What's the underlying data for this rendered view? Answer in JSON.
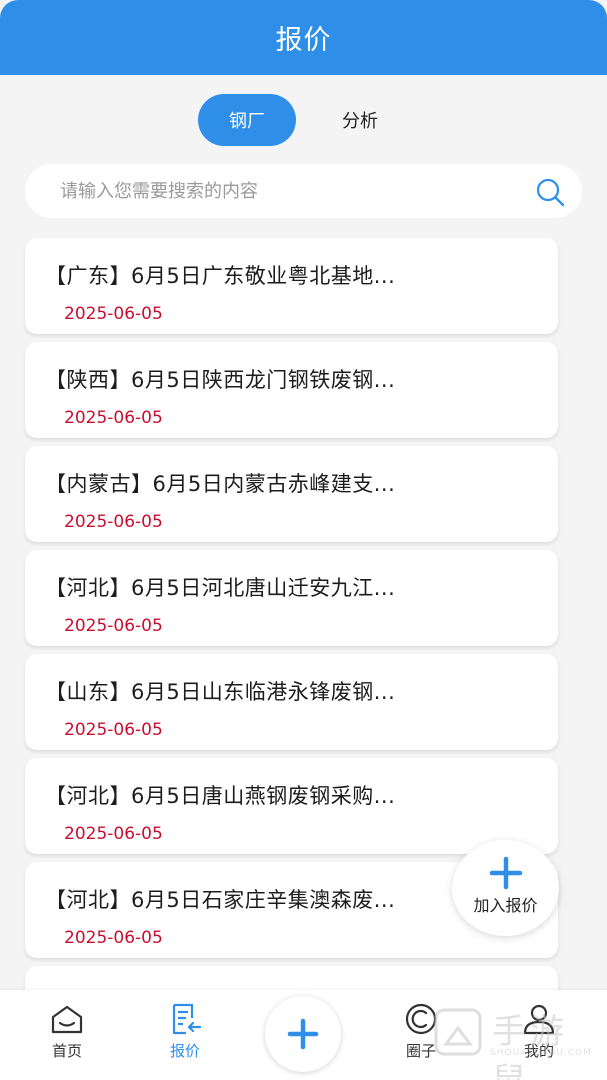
{
  "header": {
    "title": "报价"
  },
  "tabs": [
    {
      "label": "钢厂",
      "active": true
    },
    {
      "label": "分析",
      "active": false
    }
  ],
  "search": {
    "placeholder": "请输入您需要搜索的内容",
    "value": ""
  },
  "items": [
    {
      "title": "【广东】6月5日广东敬业粤北基地...",
      "date": "2025-06-05"
    },
    {
      "title": "【陕西】6月5日陕西龙门钢铁废钢...",
      "date": "2025-06-05"
    },
    {
      "title": "【内蒙古】6月5日内蒙古赤峰建支...",
      "date": "2025-06-05"
    },
    {
      "title": "【河北】6月5日河北唐山迁安九江...",
      "date": "2025-06-05"
    },
    {
      "title": "【山东】6月5日山东临港永锋废钢...",
      "date": "2025-06-05"
    },
    {
      "title": "【河北】6月5日唐山燕钢废钢采购...",
      "date": "2025-06-05"
    },
    {
      "title": "【河北】6月5日石家庄辛集澳森废...",
      "date": "2025-06-05"
    },
    {
      "title": "",
      "date": ""
    }
  ],
  "fab": {
    "label": "加入报价",
    "icon": "plus-icon"
  },
  "tabbar": [
    {
      "label": "首页",
      "icon": "home-icon",
      "active": false
    },
    {
      "label": "报价",
      "icon": "quote-list-icon",
      "active": true
    },
    {
      "label": "",
      "icon": "plus-icon",
      "active": false
    },
    {
      "label": "圈子",
      "icon": "circle-icon",
      "active": false
    },
    {
      "label": "我的",
      "icon": "user-icon",
      "active": false
    }
  ],
  "watermark": {
    "text": "手游鼠",
    "sub": "SHOUYOUSHU.COM"
  },
  "colors": {
    "primary": "#2f8fe8",
    "date": "#c8102e",
    "background": "#f4f4f4"
  }
}
